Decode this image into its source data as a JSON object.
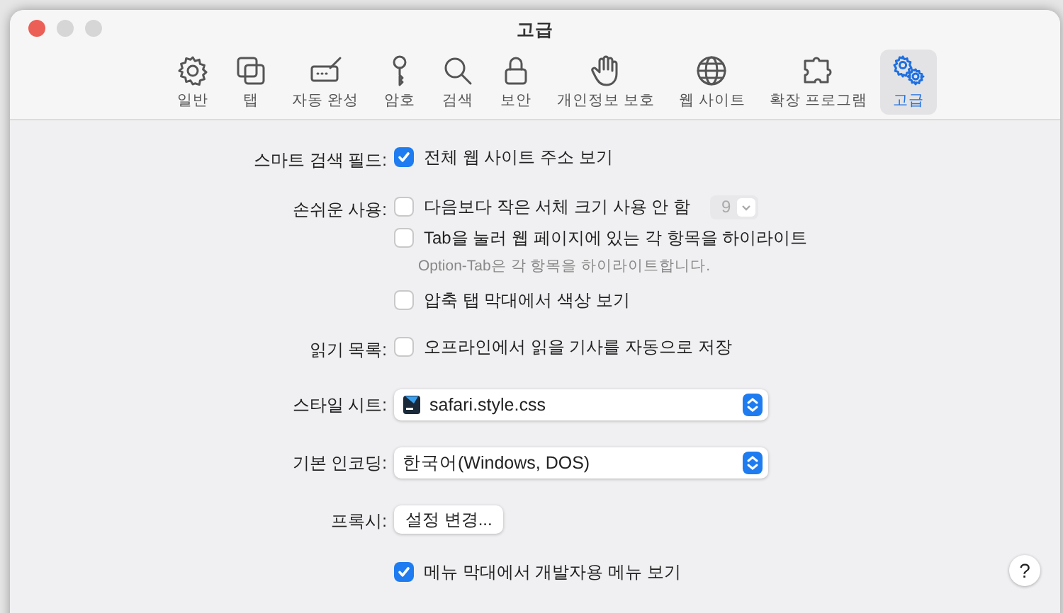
{
  "window": {
    "title": "고급"
  },
  "toolbar": [
    {
      "kind": "gear",
      "label": "일반",
      "selected": false
    },
    {
      "kind": "tabs",
      "label": "탭",
      "selected": false
    },
    {
      "kind": "autofill",
      "label": "자동 완성",
      "selected": false
    },
    {
      "kind": "key",
      "label": "암호",
      "selected": false
    },
    {
      "kind": "search",
      "label": "검색",
      "selected": false
    },
    {
      "kind": "lock",
      "label": "보안",
      "selected": false
    },
    {
      "kind": "hand",
      "label": "개인정보 보호",
      "selected": false
    },
    {
      "kind": "globe",
      "label": "웹 사이트",
      "selected": false
    },
    {
      "kind": "puzzle",
      "label": "확장 프로그램",
      "selected": false
    },
    {
      "kind": "gears",
      "label": "고급",
      "selected": true
    }
  ],
  "settings": [
    {
      "label": "스마트 검색 필드:",
      "controls": [
        {
          "kind": "checkbox",
          "label": "전체 웹 사이트 주소 보기",
          "checked": true
        }
      ]
    },
    {
      "label": "손쉬운 사용:",
      "controls": [
        {
          "kind": "checkbox_stepper",
          "label": "다음보다 작은 서체 크기 사용 안 함",
          "checked": false,
          "value": "9",
          "disabled": true
        },
        {
          "kind": "checkbox",
          "label": "Tab을 눌러 웹 페이지에 있는 각 항목을 하이라이트",
          "checked": false
        },
        {
          "kind": "hint",
          "text": "Option-Tab은 각 항목을 하이라이트합니다."
        },
        {
          "kind": "checkbox",
          "label": "압축 탭 막대에서 색상 보기",
          "checked": false
        }
      ]
    },
    {
      "label": "읽기 목록:",
      "controls": [
        {
          "kind": "checkbox",
          "label": "오프라인에서 읽을 기사를 자동으로 저장",
          "checked": false
        }
      ]
    },
    {
      "label": "스타일 시트:",
      "controls": [
        {
          "kind": "select",
          "value": "safari.style.css",
          "file_icon": true
        }
      ]
    },
    {
      "label": "기본 인코딩:",
      "controls": [
        {
          "kind": "select",
          "value": "한국어(Windows, DOS)",
          "file_icon": false
        }
      ]
    },
    {
      "label": "프록시:",
      "controls": [
        {
          "kind": "button",
          "label": "설정 변경..."
        }
      ]
    },
    {
      "controls": [
        {
          "kind": "checkbox",
          "label": "메뉴 막대에서 개발자용 메뉴 보기",
          "checked": true
        }
      ]
    }
  ],
  "help": {
    "label": "?"
  }
}
